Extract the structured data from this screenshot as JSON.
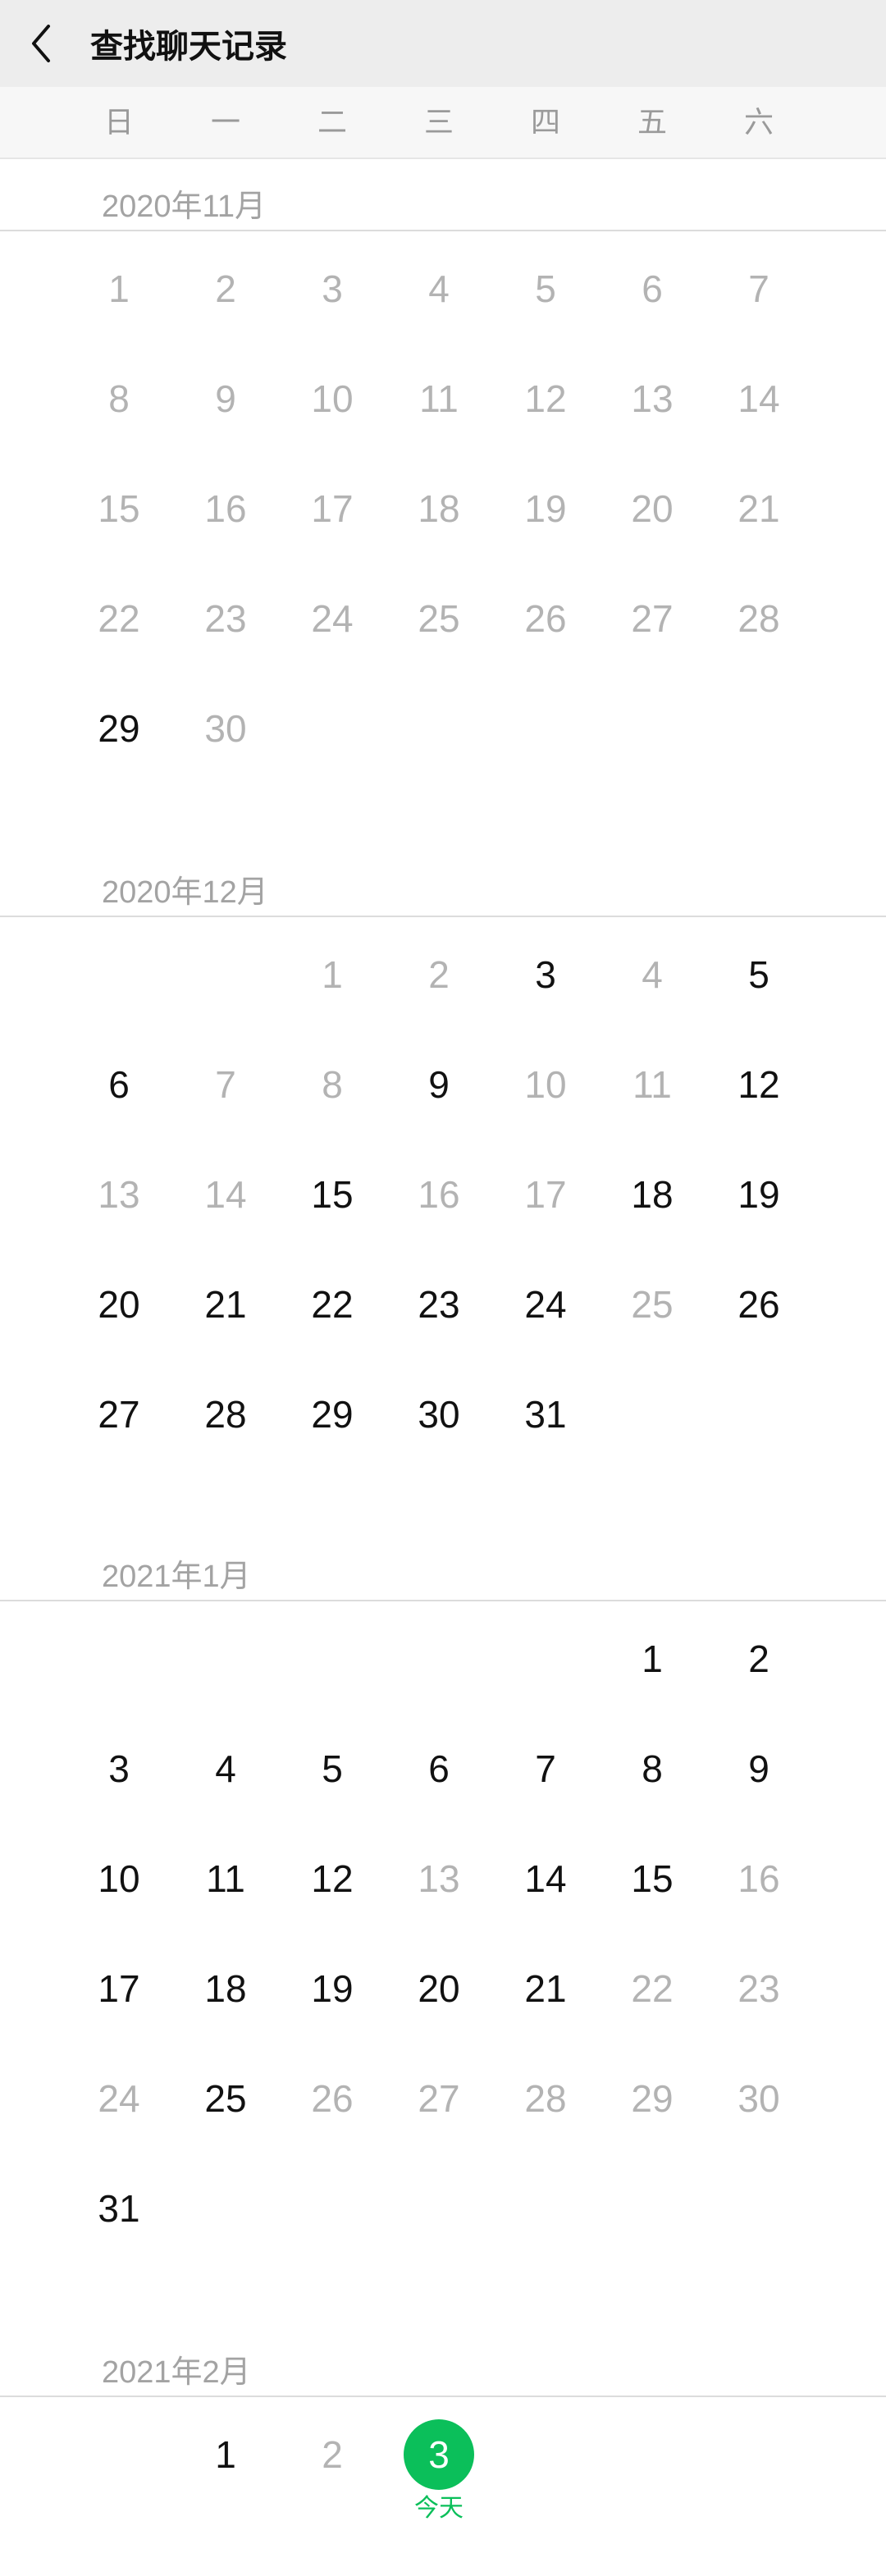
{
  "header": {
    "title": "查找聊天记录"
  },
  "weekdays": [
    "日",
    "一",
    "二",
    "三",
    "四",
    "五",
    "六"
  ],
  "today_label": "今天",
  "accent_color": "#0bbf5a",
  "months": [
    {
      "label": "2020年11月",
      "first_weekday": 0,
      "days": [
        {
          "d": "1",
          "a": false
        },
        {
          "d": "2",
          "a": false
        },
        {
          "d": "3",
          "a": false
        },
        {
          "d": "4",
          "a": false
        },
        {
          "d": "5",
          "a": false
        },
        {
          "d": "6",
          "a": false
        },
        {
          "d": "7",
          "a": false
        },
        {
          "d": "8",
          "a": false
        },
        {
          "d": "9",
          "a": false
        },
        {
          "d": "10",
          "a": false
        },
        {
          "d": "11",
          "a": false
        },
        {
          "d": "12",
          "a": false
        },
        {
          "d": "13",
          "a": false
        },
        {
          "d": "14",
          "a": false
        },
        {
          "d": "15",
          "a": false
        },
        {
          "d": "16",
          "a": false
        },
        {
          "d": "17",
          "a": false
        },
        {
          "d": "18",
          "a": false
        },
        {
          "d": "19",
          "a": false
        },
        {
          "d": "20",
          "a": false
        },
        {
          "d": "21",
          "a": false
        },
        {
          "d": "22",
          "a": false
        },
        {
          "d": "23",
          "a": false
        },
        {
          "d": "24",
          "a": false
        },
        {
          "d": "25",
          "a": false
        },
        {
          "d": "26",
          "a": false
        },
        {
          "d": "27",
          "a": false
        },
        {
          "d": "28",
          "a": false
        },
        {
          "d": "29",
          "a": true
        },
        {
          "d": "30",
          "a": false
        }
      ]
    },
    {
      "label": "2020年12月",
      "first_weekday": 2,
      "days": [
        {
          "d": "1",
          "a": false
        },
        {
          "d": "2",
          "a": false
        },
        {
          "d": "3",
          "a": true
        },
        {
          "d": "4",
          "a": false
        },
        {
          "d": "5",
          "a": true
        },
        {
          "d": "6",
          "a": true
        },
        {
          "d": "7",
          "a": false
        },
        {
          "d": "8",
          "a": false
        },
        {
          "d": "9",
          "a": true
        },
        {
          "d": "10",
          "a": false
        },
        {
          "d": "11",
          "a": false
        },
        {
          "d": "12",
          "a": true
        },
        {
          "d": "13",
          "a": false
        },
        {
          "d": "14",
          "a": false
        },
        {
          "d": "15",
          "a": true
        },
        {
          "d": "16",
          "a": false
        },
        {
          "d": "17",
          "a": false
        },
        {
          "d": "18",
          "a": true
        },
        {
          "d": "19",
          "a": true
        },
        {
          "d": "20",
          "a": true
        },
        {
          "d": "21",
          "a": true
        },
        {
          "d": "22",
          "a": true
        },
        {
          "d": "23",
          "a": true
        },
        {
          "d": "24",
          "a": true
        },
        {
          "d": "25",
          "a": false
        },
        {
          "d": "26",
          "a": true
        },
        {
          "d": "27",
          "a": true
        },
        {
          "d": "28",
          "a": true
        },
        {
          "d": "29",
          "a": true
        },
        {
          "d": "30",
          "a": true
        },
        {
          "d": "31",
          "a": true
        }
      ]
    },
    {
      "label": "2021年1月",
      "first_weekday": 5,
      "days": [
        {
          "d": "1",
          "a": true
        },
        {
          "d": "2",
          "a": true
        },
        {
          "d": "3",
          "a": true
        },
        {
          "d": "4",
          "a": true
        },
        {
          "d": "5",
          "a": true
        },
        {
          "d": "6",
          "a": true
        },
        {
          "d": "7",
          "a": true
        },
        {
          "d": "8",
          "a": true
        },
        {
          "d": "9",
          "a": true
        },
        {
          "d": "10",
          "a": true
        },
        {
          "d": "11",
          "a": true
        },
        {
          "d": "12",
          "a": true
        },
        {
          "d": "13",
          "a": false
        },
        {
          "d": "14",
          "a": true
        },
        {
          "d": "15",
          "a": true
        },
        {
          "d": "16",
          "a": false
        },
        {
          "d": "17",
          "a": true
        },
        {
          "d": "18",
          "a": true
        },
        {
          "d": "19",
          "a": true
        },
        {
          "d": "20",
          "a": true
        },
        {
          "d": "21",
          "a": true
        },
        {
          "d": "22",
          "a": false
        },
        {
          "d": "23",
          "a": false
        },
        {
          "d": "24",
          "a": false
        },
        {
          "d": "25",
          "a": true
        },
        {
          "d": "26",
          "a": false
        },
        {
          "d": "27",
          "a": false
        },
        {
          "d": "28",
          "a": false
        },
        {
          "d": "29",
          "a": false
        },
        {
          "d": "30",
          "a": false
        },
        {
          "d": "31",
          "a": true
        }
      ]
    },
    {
      "label": "2021年2月",
      "first_weekday": 1,
      "days": [
        {
          "d": "1",
          "a": true
        },
        {
          "d": "2",
          "a": false
        },
        {
          "d": "3",
          "a": true,
          "today": true
        }
      ]
    }
  ]
}
